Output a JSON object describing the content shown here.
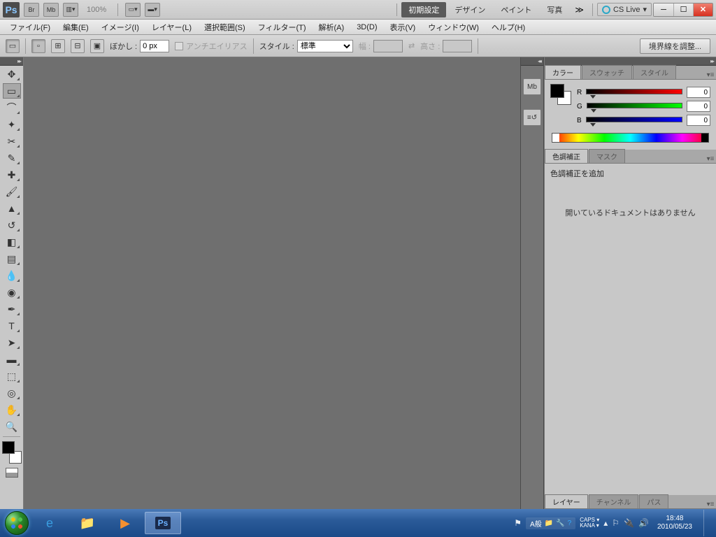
{
  "appbar": {
    "logo": "Ps",
    "mini_buttons": [
      "Br",
      "Mb"
    ],
    "zoom": "100%",
    "workspace_tabs": [
      "初期設定",
      "デザイン",
      "ペイント",
      "写真"
    ],
    "workspace_selected": 0,
    "cslive": "CS Live"
  },
  "menubar": [
    "ファイル(F)",
    "編集(E)",
    "イメージ(I)",
    "レイヤー(L)",
    "選択範囲(S)",
    "フィルター(T)",
    "解析(A)",
    "3D(D)",
    "表示(V)",
    "ウィンドウ(W)",
    "ヘルプ(H)"
  ],
  "options": {
    "feather_label": "ぼかし :",
    "feather_value": "0 px",
    "antialias": "アンチエイリアス",
    "style_label": "スタイル :",
    "style_value": "標準",
    "width_label": "幅 :",
    "height_label": "高さ :",
    "refine": "境界線を調整..."
  },
  "panels": {
    "color_tabs": [
      "カラー",
      "スウォッチ",
      "スタイル"
    ],
    "rgb": {
      "R": "0",
      "G": "0",
      "B": "0"
    },
    "adjust_tabs": [
      "色調補正",
      "マスク"
    ],
    "adjust_add": "色調補正を追加",
    "adjust_msg": "開いているドキュメントはありません",
    "layer_tabs": [
      "レイヤー",
      "チャンネル",
      "パス"
    ]
  },
  "taskbar": {
    "ime": "A般",
    "caps": "CAPS",
    "kana": "KANA",
    "time": "18:48",
    "date": "2010/05/23"
  }
}
